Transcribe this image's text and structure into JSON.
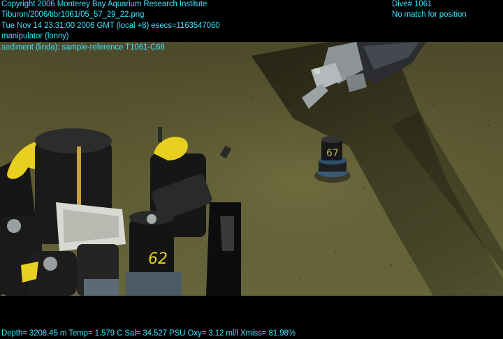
{
  "overlay": {
    "top_left": [
      "Copyright 2006 Monterey Bay Aquarium Research Institute",
      "Tiburon/2006/tibr1061/05_57_29_22.png",
      "Tue Nov 14 23:31:00 2006 GMT (local +8)  esecs=1163547060",
      "manipulator (lonny)",
      "sediment (linda): sample-reference T1061-C68"
    ],
    "top_right": [
      "Dive# 1061",
      "No match for position"
    ],
    "bottom": "Depth= 3208.45 m  Temp= 1.579 C  Sal= 34.527 PSU  Oxy= 3.12 ml/l  Xmiss= 81.98%"
  },
  "scene": {
    "core_labels": [
      "67",
      "62"
    ],
    "colors": {
      "seafloor": "#5a5630",
      "overlay_text": "#3ee3ff",
      "float_yellow": "#e8d020"
    }
  }
}
